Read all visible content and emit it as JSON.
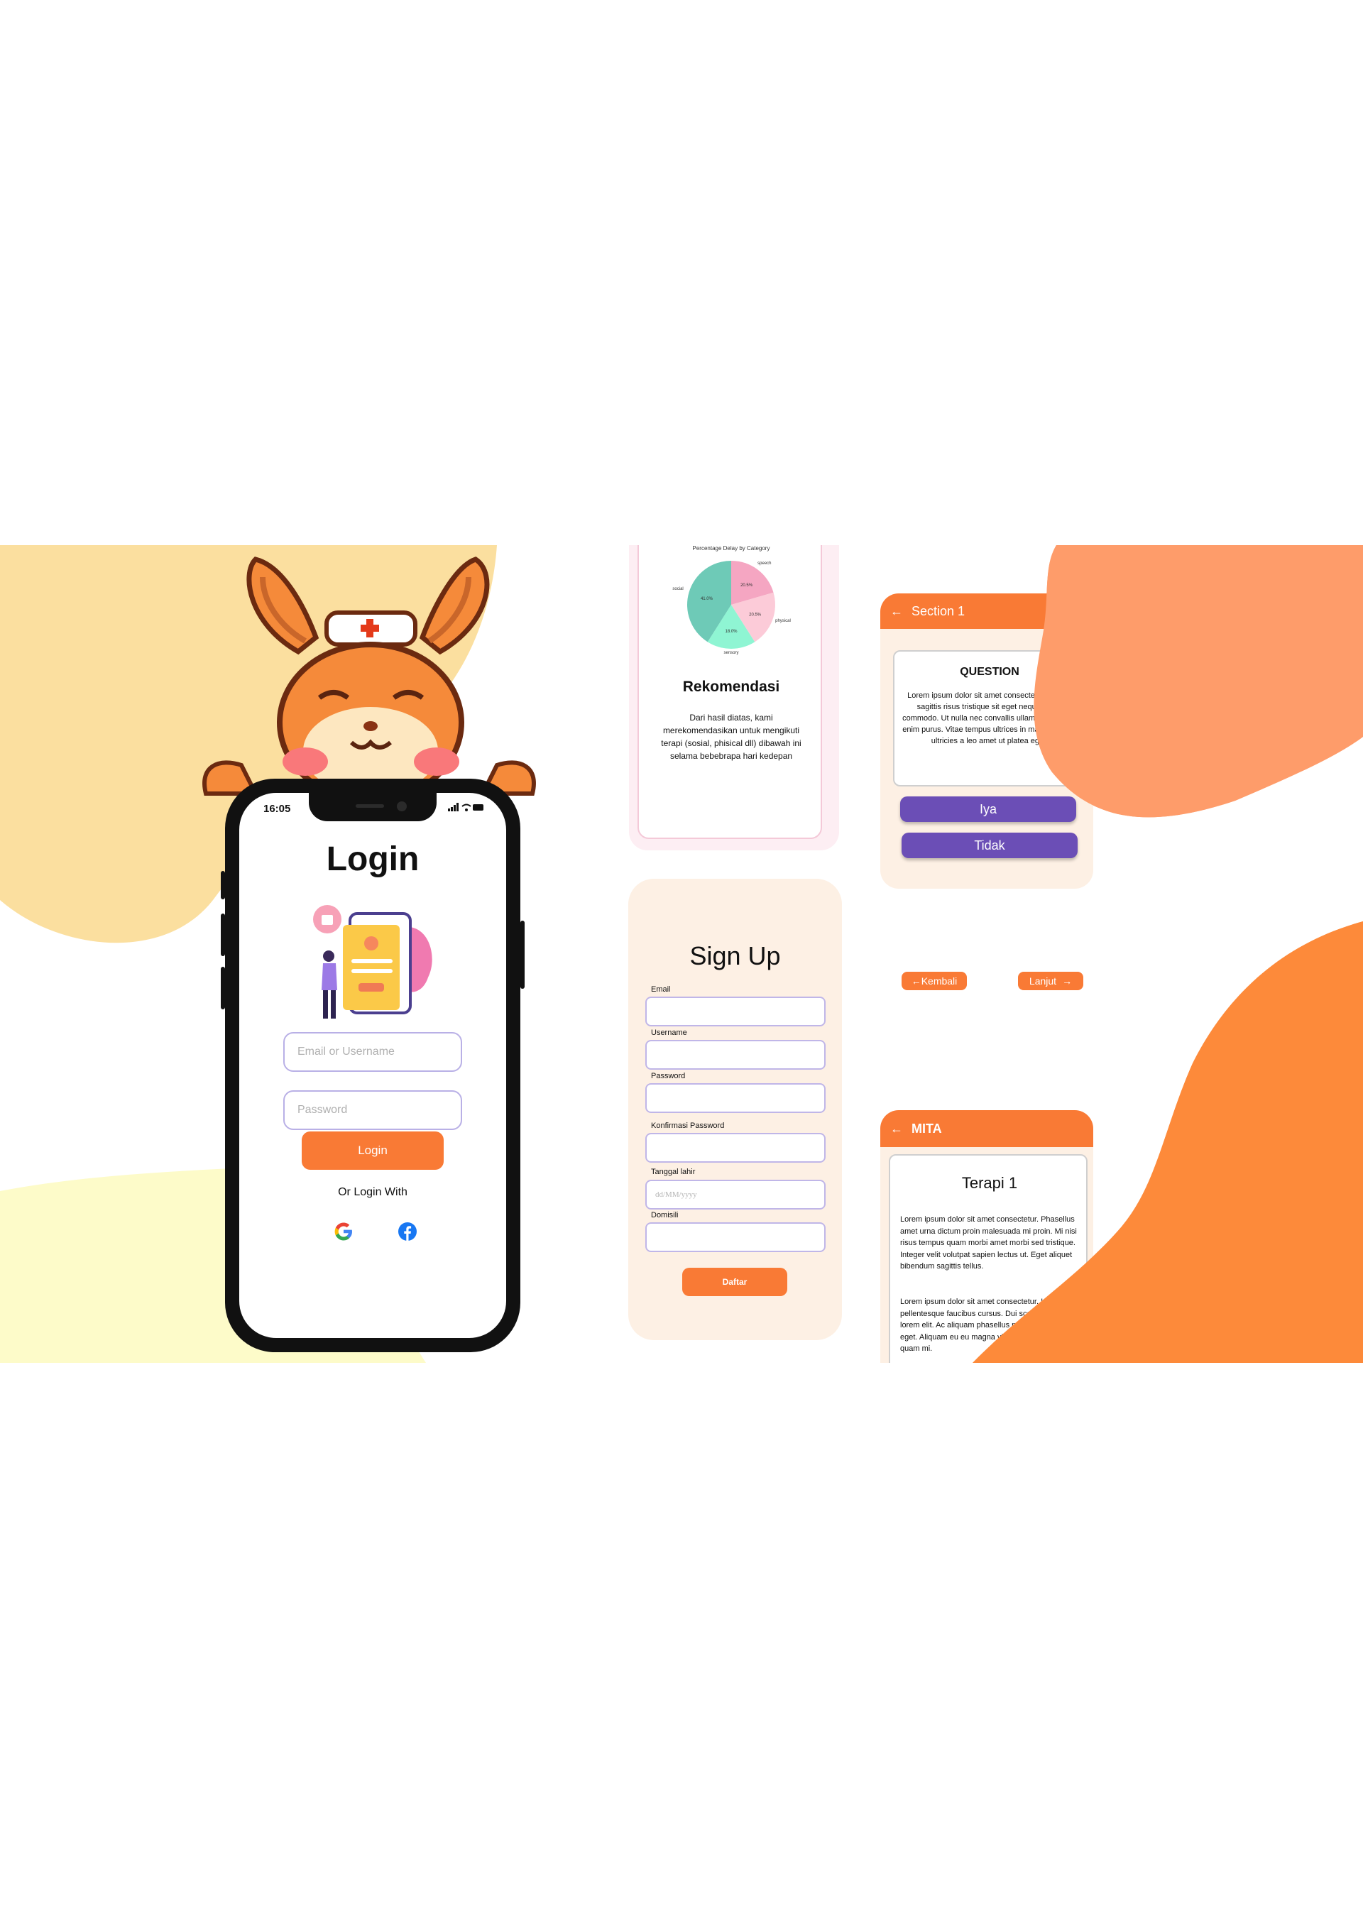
{
  "colors": {
    "accent_orange": "#f97a35",
    "purple_button": "#6b4eb6",
    "peach_card": "#fdf0e4",
    "pink_card": "#fdeef3",
    "yellow_blob": "#fbdf9f",
    "pale_yellow_blob": "#fdfbc9",
    "salmon_blob": "#fe9c6a"
  },
  "login_screen": {
    "status_time": "16:05",
    "title": "Login",
    "email_placeholder": "Email or Username",
    "password_placeholder": "Password",
    "login_button": "Login",
    "or_login_with": "Or Login With",
    "social": [
      "google-icon",
      "facebook-icon"
    ]
  },
  "recommendation_screen": {
    "chart_data": {
      "type": "pie",
      "title": "Percentage Delay by Category",
      "labels": [
        "speech",
        "physical",
        "sensory",
        "social"
      ],
      "values": [
        20.5,
        20.5,
        18.0,
        41.0
      ],
      "value_labels": [
        "20.5%",
        "20.5%",
        "18.0%",
        "41.0%"
      ],
      "colors": [
        "#f5a6c2",
        "#fccbd8",
        "#8ff5d3",
        "#6ecab7"
      ]
    },
    "title": "Rekomendasi",
    "text": "Dari hasil diatas, kami merekomendasikan untuk mengikuti terapi (sosial, phisical dll) dibawah ini selama bebebrapa hari kedepan"
  },
  "signup_screen": {
    "title": "Sign Up",
    "fields": [
      {
        "label": "Email",
        "placeholder": ""
      },
      {
        "label": "Username",
        "placeholder": ""
      },
      {
        "label": "Password",
        "placeholder": ""
      },
      {
        "label": "Konfirmasi Password",
        "placeholder": ""
      },
      {
        "label": "Tanggal lahir",
        "placeholder": "dd/MM/yyyy"
      },
      {
        "label": "Domisili",
        "placeholder": ""
      }
    ],
    "submit_button": "Daftar"
  },
  "question_screen": {
    "header": "Section 1",
    "heading": "QUESTION",
    "text": "Lorem ipsum dolor sit amet consectetur. Magna sagittis risus tristique sit eget neque lorem commodo. Ut nulla nec convallis ullamcorper amet enim purus. Vitae tempus ultrices in mauris. Lacus ultricies a leo amet ut platea eget.",
    "answer_yes": "Iya",
    "answer_no": "Tidak",
    "back_button": "Kembali",
    "next_button": "Lanjut"
  },
  "therapy_screen": {
    "header": "MITA",
    "title": "Terapi 1",
    "paragraph_1": "Lorem ipsum dolor sit amet consectetur. Phasellus amet urna dictum proin malesuada mi proin. Mi nisi risus tempus quam morbi amet morbi sed tristique. Integer velit volutpat sapien lectus ut. Eget aliquet bibendum sagittis tellus.",
    "paragraph_2": "Lorem ipsum dolor sit amet consectetur. Id libero pellentesque faucibus cursus. Dui scelerisque lorem elit. Ac aliquam phasellus mattis velit sed eget. Aliquam eu eu magna vitae blandit eget quam mi."
  }
}
